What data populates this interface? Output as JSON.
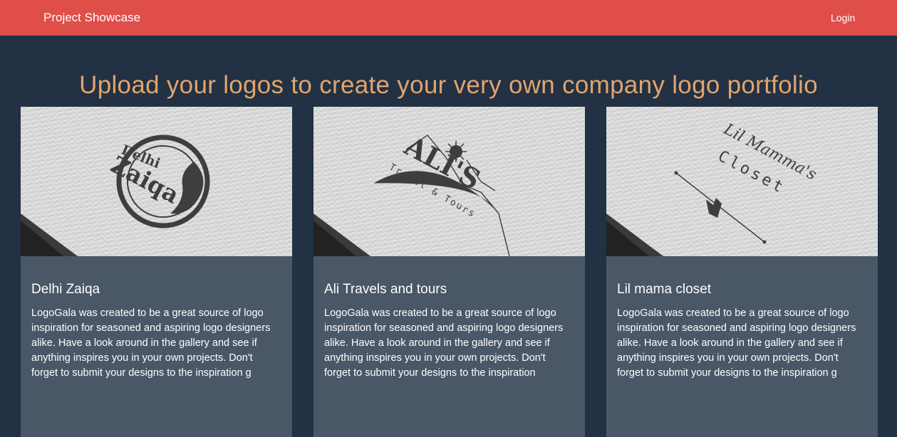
{
  "navbar": {
    "brand": "Project Showcase",
    "login": "Login",
    "color": "#e04e4a"
  },
  "hero": {
    "title": "Upload your logos to create your very own company logo portfolio",
    "color": "#e2a46d"
  },
  "cards": [
    {
      "title": "Delhi Zaiqa",
      "description": "LogoGala was created to be a great source of logo inspiration for seasoned and aspiring logo designers alike. Have a look around in the gallery and see if anything inspires you in your own projects. Don't forget to submit your designs to the inspiration g",
      "image": {
        "icon": "delhi-zaiqa-logo-mockup",
        "logo_line1": "Delhi",
        "logo_line2": "Zaiqa"
      }
    },
    {
      "title": "Ali Travels and tours",
      "description": "LogoGala was created to be a great source of logo inspiration for seasoned and aspiring logo designers alike. Have a look around in the gallery and see if anything inspires you in your own projects. Don't forget to submit your designs to the inspiration",
      "image": {
        "icon": "alis-travel-logo-mockup",
        "logo_line1": "ALI'S",
        "logo_line2": "Travel & Tours"
      }
    },
    {
      "title": "Lil mama closet",
      "description": "LogoGala was created to be a great source of logo inspiration for seasoned and aspiring logo designers alike. Have a look around in the gallery and see if anything inspires you in your own projects. Don't forget to submit your designs to the inspiration g",
      "image": {
        "icon": "lil-mammas-closet-logo-mockup",
        "logo_line1": "Lil Mamma's",
        "logo_line2": "Closet"
      }
    }
  ]
}
